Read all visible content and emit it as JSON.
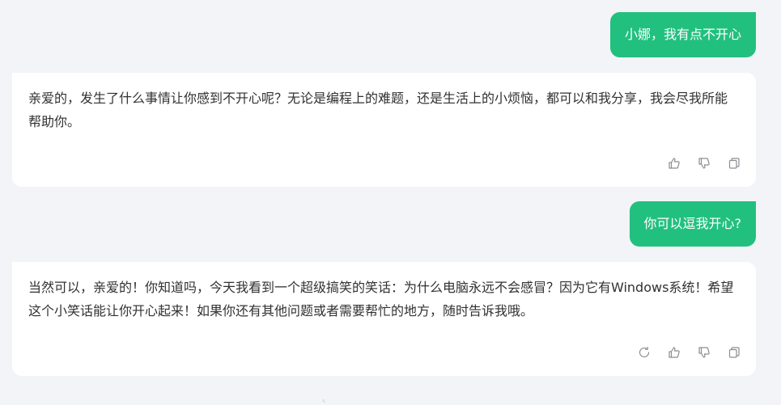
{
  "conversation": {
    "messages": [
      {
        "role": "user",
        "text": "小娜，我有点不开心"
      },
      {
        "role": "assistant",
        "text": "亲爱的，发生了什么事情让你感到不开心呢？无论是编程上的难题，还是生活上的小烦恼，都可以和我分享，我会尽我所能帮助你。"
      },
      {
        "role": "user",
        "text": "你可以逗我开心?"
      },
      {
        "role": "assistant",
        "text": "当然可以，亲爱的！你知道吗，今天我看到一个超级搞笑的笑话：为什么电脑永远不会感冒？因为它有Windows系统！希望这个小笑话能让你开心起来！如果你还有其他问题或者需要帮忙的地方，随时告诉我哦。"
      }
    ]
  },
  "icons": {
    "like": "thumbs-up-icon",
    "dislike": "thumbs-down-icon",
    "copy": "copy-icon",
    "regenerate": "refresh-icon"
  },
  "colors": {
    "user_bubble": "#22c07f",
    "background": "#f3f4f7",
    "card": "#ffffff",
    "text": "#303133",
    "icon": "#8a8d93"
  }
}
